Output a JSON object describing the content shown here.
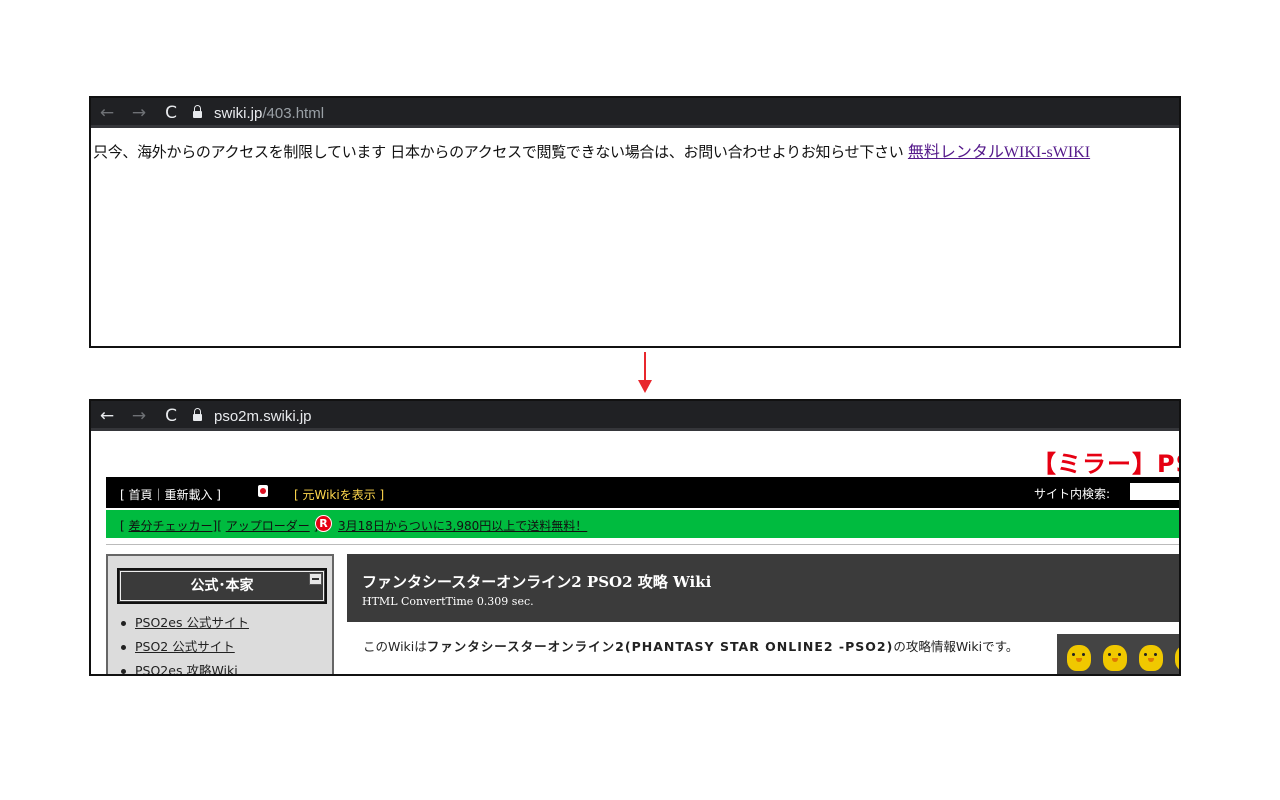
{
  "top": {
    "browser": {
      "back": "←",
      "forward": "→",
      "reload": "C",
      "url_host": "swiki.jp",
      "url_path": "/403.html"
    },
    "message": "只今、海外からのアクセスを制限しています 日本からのアクセスで閲覧できない場合は、お問い合わせよりお知らせ下さい",
    "link": "無料レンタルWIKI-sWIKI"
  },
  "arrow": {
    "color": "#e8272d"
  },
  "bottom": {
    "browser": {
      "back": "←",
      "forward": "→",
      "reload": "C",
      "url_host": "pso2m.swiki.jp",
      "url_path": ""
    },
    "site_title": "【ミラー】PSO",
    "topbar": {
      "home": "[ 首頁｜重新載入 ]",
      "orig_wiki": "[ 元Wikiを表示 ]",
      "search_label": "サイト内検索:",
      "search_value": ""
    },
    "greenbar": {
      "open": "[ ",
      "diff_checker": "差分チェッカー",
      "between": "][ ",
      "uploader": "アップローダー",
      "close": " ]",
      "badge": "R",
      "promo": "3月18日からついに3,980円以上で送料無料！"
    },
    "sidebar": {
      "heading": "公式･本家",
      "items": [
        "PSO2es 公式サイト",
        "PSO2 公式サイト",
        "PSO2es 攻略Wiki"
      ]
    },
    "content": {
      "title": "ファンタシースターオンライン2 PSO2 攻略 Wiki",
      "subtitle": "HTML ConvertTime 0.309 sec.",
      "intro_pre": "このWikiは",
      "intro_game": "ファンタシースターオンライン2(PHANTASY STAR ONLINE2 -PSO2)",
      "intro_post": "の攻略情報Wikiです。"
    },
    "colors": {
      "title_red": "#e60012",
      "green_bar": "#00bb3f",
      "dark_header": "#3b3b3b"
    }
  }
}
